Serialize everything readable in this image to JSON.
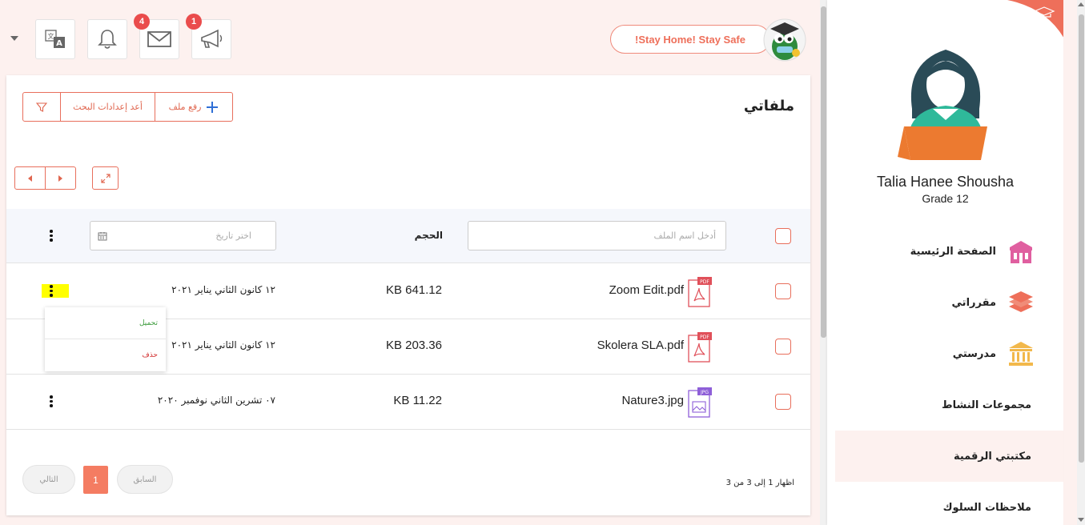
{
  "header": {
    "announcements_badge": "1",
    "messages_badge": "4",
    "stay_home_text": "!Stay Home! Stay Safe"
  },
  "files_page": {
    "title": "ملفاتي",
    "upload_label": "رفع ملف",
    "reset_search_label": "أعد إعدادات البحث",
    "name_filter_placeholder": "أدخل اسم الملف",
    "size_header": "الحجم",
    "date_filter_placeholder": "اختر تاريخ",
    "rows": [
      {
        "name": "Zoom Edit.pdf",
        "type": "PDF",
        "size": "KB 641.12",
        "date": "١٢ كانون الثاني يناير ٢٠٢١"
      },
      {
        "name": "Skolera SLA.pdf",
        "type": "PDF",
        "size": "KB 203.36",
        "date": "١٢ كانون الثاني يناير ٢٠٢١"
      },
      {
        "name": "Nature3.jpg",
        "type": "JPG",
        "size": "KB 11.22",
        "date": "٠٧ تشرين الثاني نوفمبر ٢٠٢٠"
      }
    ],
    "context_menu": {
      "download": "تحميل",
      "delete": "حذف"
    },
    "pagination": {
      "info": "اظهار 1 إلى 3 من 3",
      "previous": "السابق",
      "current": "1",
      "next": "التالي"
    }
  },
  "sidebar": {
    "student_name": "Talia Hanee Shousha",
    "grade": "Grade 12",
    "items": [
      {
        "label": "الصفحة الرئيسية",
        "icon": "school-building-icon",
        "color": "#e05fa0"
      },
      {
        "label": "مقرراتي",
        "icon": "books-stack-icon",
        "color": "#ee6f5a"
      },
      {
        "label": "مدرستي",
        "icon": "institution-icon",
        "color": "#f2b84b"
      },
      {
        "label": "مجموعات النشاط"
      },
      {
        "label": "مكتبتي الرقمية",
        "active": true
      },
      {
        "label": "ملاحظات السلوك"
      }
    ]
  },
  "colors": {
    "accent": "#e86f5c",
    "badge": "#ea4c4c",
    "page_bg": "#fdf1ef",
    "pdf_icon": "#e0505a",
    "jpg_icon": "#8e5fd8"
  }
}
